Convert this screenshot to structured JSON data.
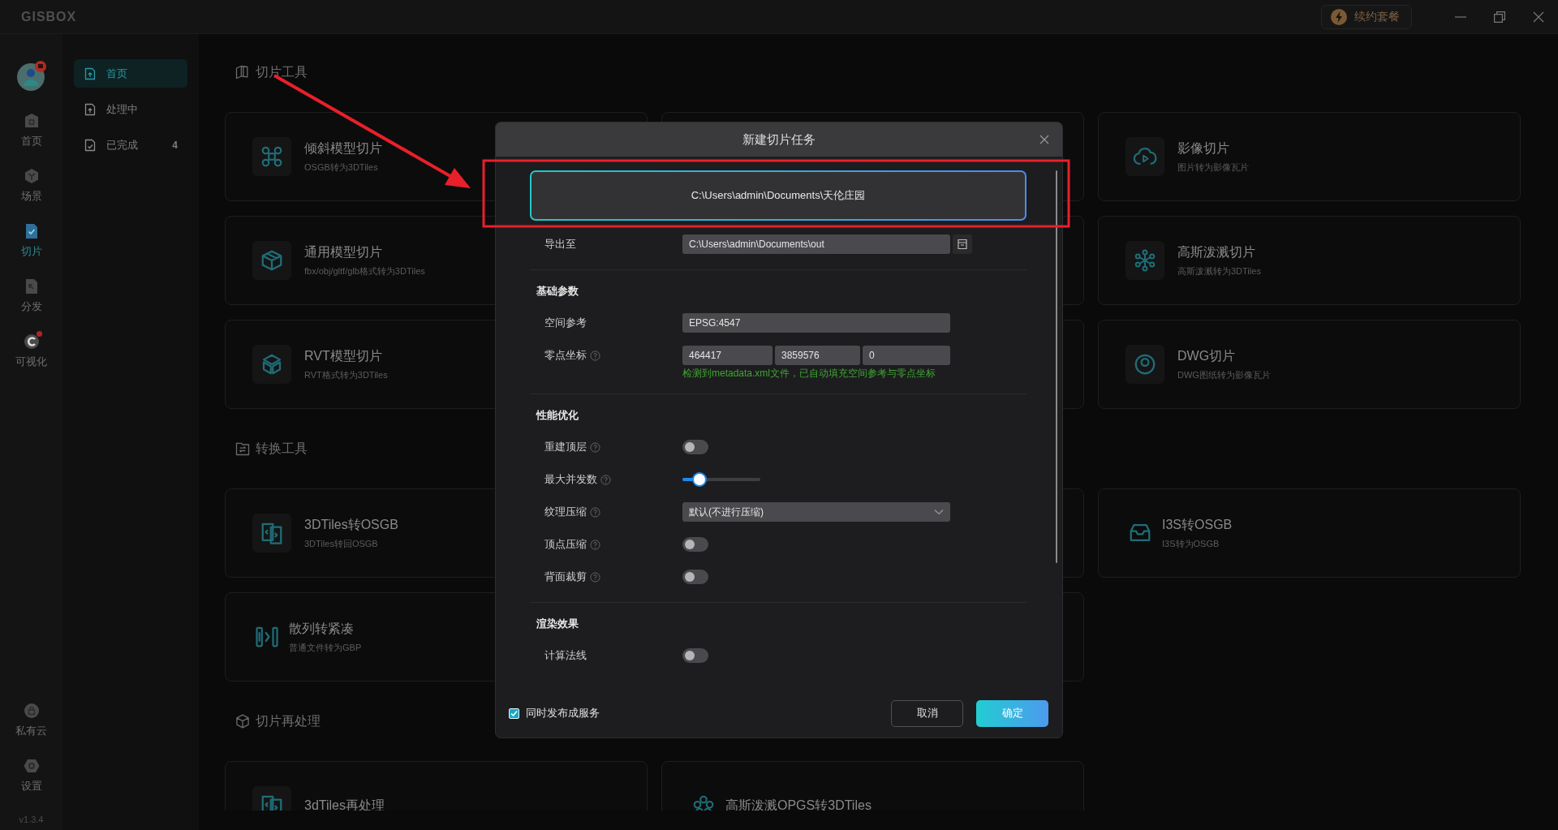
{
  "title_bar": {
    "logo": "GISBOX",
    "renew_button": "续约套餐"
  },
  "rail": {
    "items": [
      {
        "label": "首页",
        "selected": false,
        "dot": false
      },
      {
        "label": "场景",
        "selected": false,
        "dot": false
      },
      {
        "label": "切片",
        "selected": true,
        "dot": false
      },
      {
        "label": "分发",
        "selected": false,
        "dot": false
      },
      {
        "label": "可视化",
        "selected": false,
        "dot": true
      }
    ],
    "bottom_items": [
      {
        "label": "私有云",
        "selected": false,
        "dot": false
      },
      {
        "label": "设置",
        "selected": false,
        "dot": false
      }
    ],
    "version": "v1.3.4"
  },
  "subnav": [
    {
      "label": "首页",
      "selected": true
    },
    {
      "label": "处理中",
      "selected": false
    },
    {
      "label": "已完成",
      "count": "4",
      "selected": false
    }
  ],
  "sections": [
    {
      "title": "切片工具",
      "cards": [
        {
          "kind": "boxed",
          "title": "倾斜模型切片",
          "subtitle": "OSGB转为3DTiles"
        },
        {
          "kind": "covered"
        },
        {
          "kind": "boxed",
          "title": "影像切片",
          "subtitle": "图片转为影像瓦片"
        },
        {
          "kind": "boxed",
          "title": "通用模型切片",
          "subtitle": "fbx/obj/gltf/glb格式转为3DTiles"
        },
        {
          "kind": "covered"
        },
        {
          "kind": "boxed",
          "title": "高斯泼溅切片",
          "subtitle": "高斯泼溅转为3DTiles"
        },
        {
          "kind": "boxed",
          "title": "RVT模型切片",
          "subtitle": "RVT格式转为3DTiles"
        },
        {
          "kind": "covered"
        },
        {
          "kind": "boxed",
          "title": "DWG切片",
          "subtitle": "DWG图纸转为影像瓦片"
        }
      ]
    },
    {
      "title": "转换工具",
      "cards": [
        {
          "kind": "boxed",
          "title": "3DTiles转OSGB",
          "subtitle": "3DTiles转回OSGB"
        },
        {
          "kind": "covered"
        },
        {
          "kind": "bare",
          "title": "I3S转OSGB",
          "subtitle": "I3S转为OSGB"
        },
        {
          "kind": "bare",
          "title": "散列转紧凑",
          "subtitle": "普通文件转为GBP"
        },
        {
          "kind": "covered"
        }
      ]
    },
    {
      "title": "切片再处理",
      "cards": [
        {
          "kind": "boxed",
          "title": "3dTiles再处理"
        },
        {
          "kind": "bare",
          "title": "高斯泼溅OPGS转3DTiles"
        }
      ]
    }
  ],
  "dialog": {
    "title": "新建切片任务",
    "source_path": "C:\\Users\\admin\\Documents\\天伦庄园",
    "export": {
      "label": "导出至",
      "value": "C:\\Users\\admin\\Documents\\out"
    },
    "groups": [
      {
        "heading": "基础参数",
        "rows": [
          {
            "kind": "text",
            "label": "空间参考",
            "help": false,
            "value": "EPSG:4547"
          },
          {
            "kind": "coords",
            "label": "零点坐标",
            "help": true,
            "values": [
              "464417",
              "3859576",
              "0"
            ],
            "note": "检测到metadata.xml文件，已自动填充空间参考与零点坐标"
          }
        ]
      },
      {
        "heading": "性能优化",
        "rows": [
          {
            "kind": "toggle",
            "label": "重建顶层",
            "help": true,
            "on": false
          },
          {
            "kind": "slider",
            "label": "最大并发数",
            "help": true,
            "level": 0.22
          },
          {
            "kind": "select",
            "label": "纹理压缩",
            "help": true,
            "value": "默认(不进行压缩)"
          },
          {
            "kind": "toggle",
            "label": "顶点压缩",
            "help": true,
            "on": false
          },
          {
            "kind": "toggle",
            "label": "背面裁剪",
            "help": true,
            "on": false
          }
        ]
      },
      {
        "heading": "渲染效果",
        "rows": [
          {
            "kind": "toggle",
            "label": "计算法线",
            "help": false,
            "on": false
          }
        ]
      }
    ],
    "publish": {
      "label": "同时发布成服务",
      "checked": true
    },
    "buttons": [
      {
        "label": "取消",
        "kind": "secondary"
      },
      {
        "label": "确定",
        "kind": "primary"
      }
    ]
  }
}
